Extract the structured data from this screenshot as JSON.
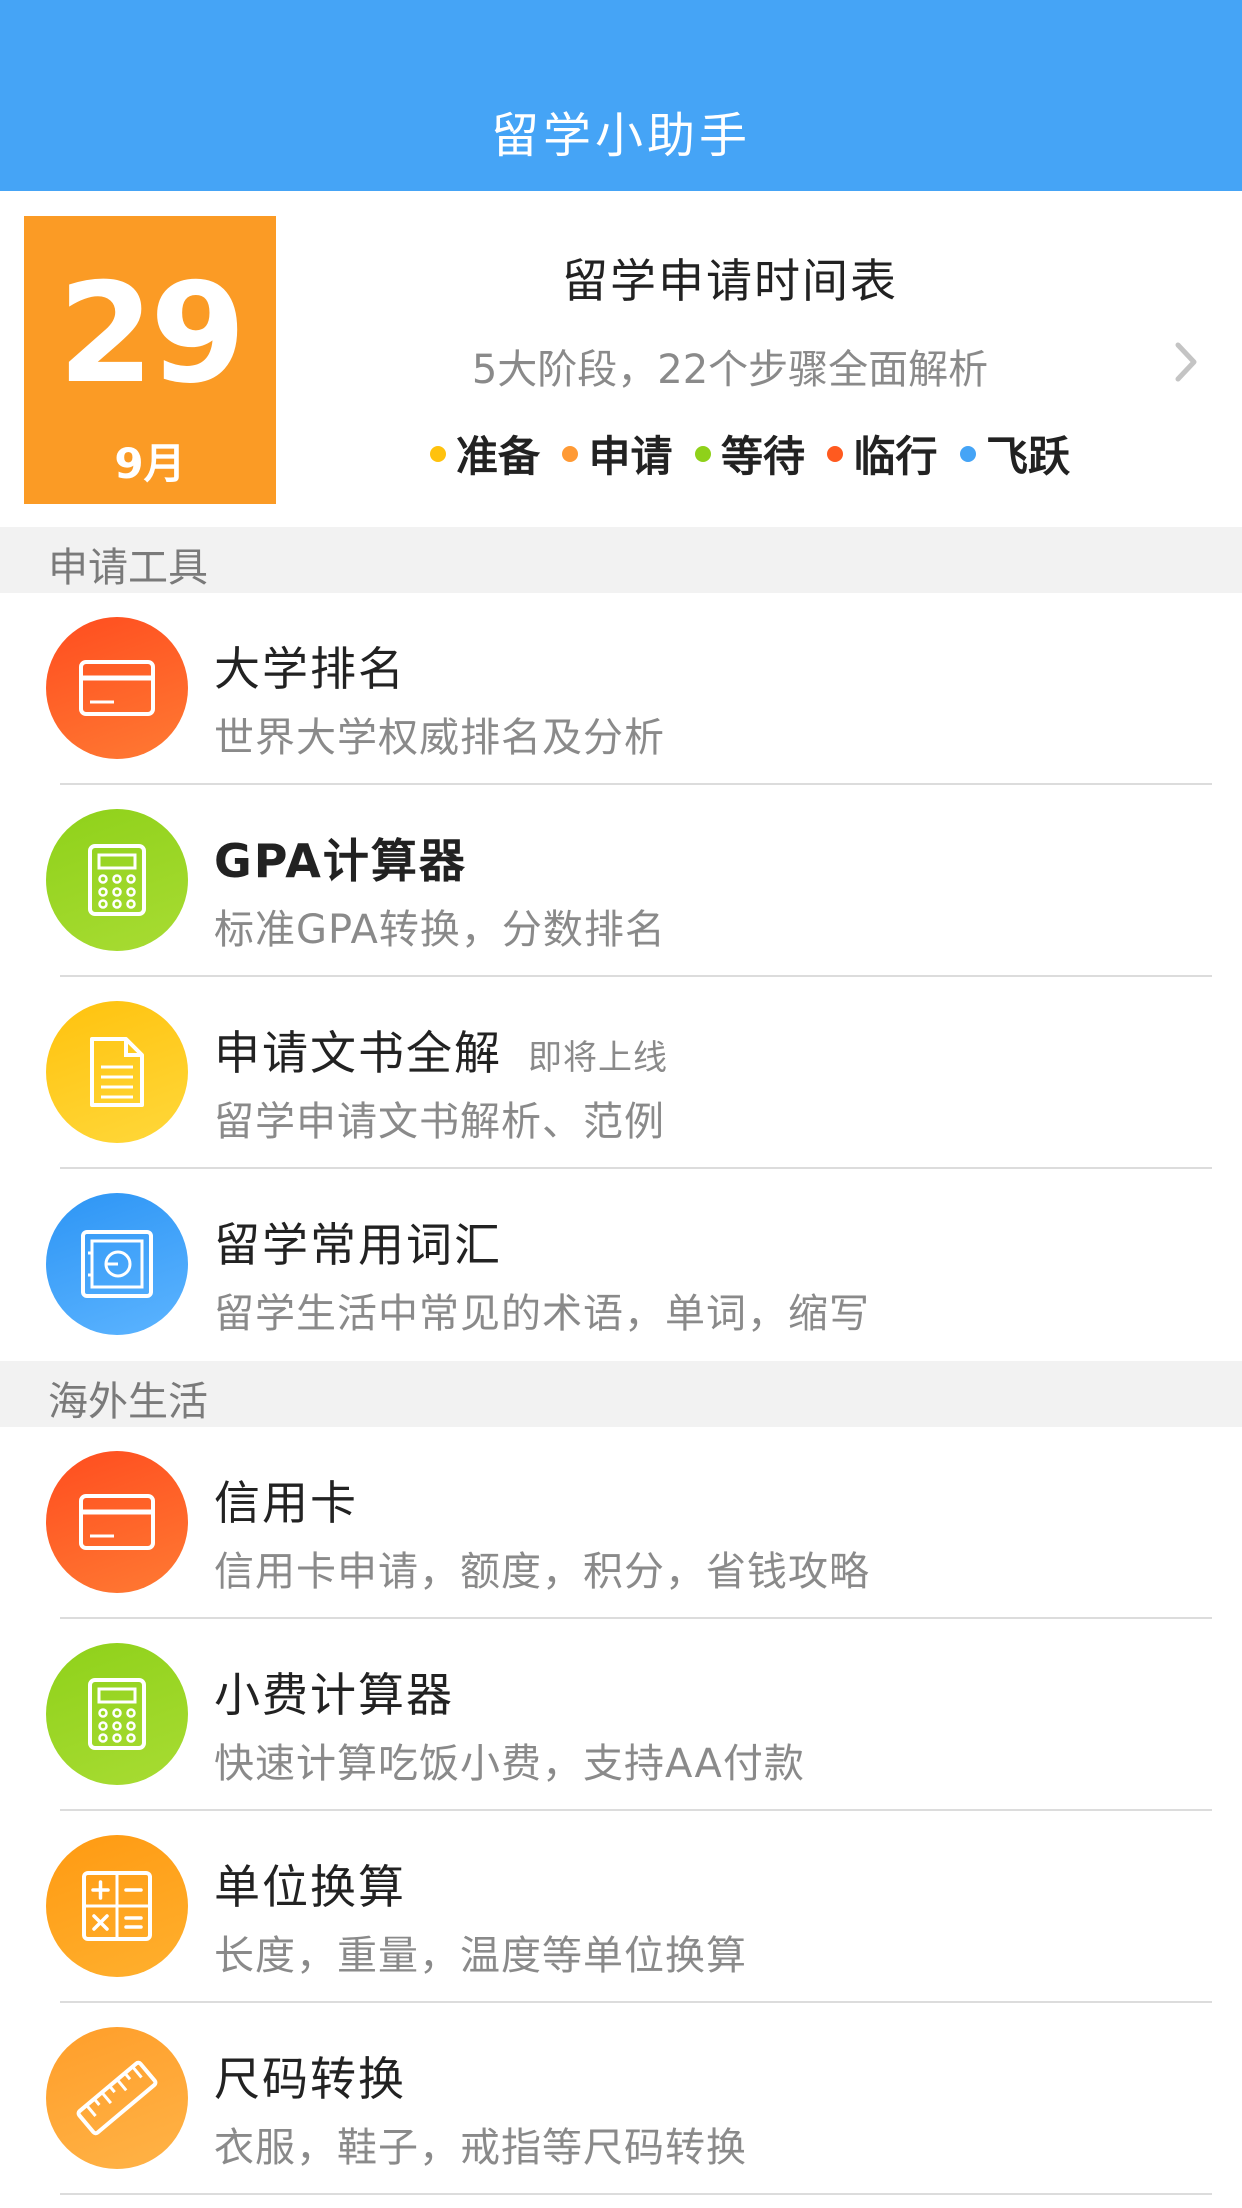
{
  "app": {
    "title": "留学小助手"
  },
  "timeline": {
    "day": "29",
    "month": "9月",
    "title": "留学申请时间表",
    "subtitle": "5大阶段，22个步骤全面解析",
    "stages": [
      {
        "label": "准备",
        "color": "#ffc20e"
      },
      {
        "label": "申请",
        "color": "#ff9a35"
      },
      {
        "label": "等待",
        "color": "#8fd11a"
      },
      {
        "label": "临行",
        "color": "#ff5a1f"
      },
      {
        "label": "飞跃",
        "color": "#45a4f6"
      }
    ],
    "chevron_icon": "chevron-right-icon"
  },
  "sections": [
    {
      "header": "申请工具",
      "items": [
        {
          "title": "大学排名",
          "subtitle": "世界大学权威排名及分析",
          "icon": "card-icon",
          "color": "red"
        },
        {
          "title": "GPA计算器",
          "subtitle": "标准GPA转换，分数排名",
          "icon": "calculator-icon",
          "color": "green"
        },
        {
          "title": "申请文书全解",
          "badge": "即将上线",
          "subtitle": "留学申请文书解析、范例",
          "icon": "document-icon",
          "color": "yellow"
        },
        {
          "title": "留学常用词汇",
          "subtitle": "留学生活中常见的术语，单词，缩写",
          "icon": "safe-icon",
          "color": "blue"
        }
      ]
    },
    {
      "header": "海外生活",
      "items": [
        {
          "title": "信用卡",
          "subtitle": "信用卡申请，额度，积分，省钱攻略",
          "icon": "card-icon",
          "color": "red"
        },
        {
          "title": "小费计算器",
          "subtitle": "快速计算吃饭小费，支持AA付款",
          "icon": "calculator-icon",
          "color": "green"
        },
        {
          "title": "单位换算",
          "subtitle": "长度，重量，温度等单位换算",
          "icon": "math-symbols-icon",
          "color": "orange"
        },
        {
          "title": "尺码转换",
          "subtitle": "衣服，鞋子，戒指等尺码转换",
          "icon": "ruler-icon",
          "color": "orange"
        }
      ]
    }
  ]
}
